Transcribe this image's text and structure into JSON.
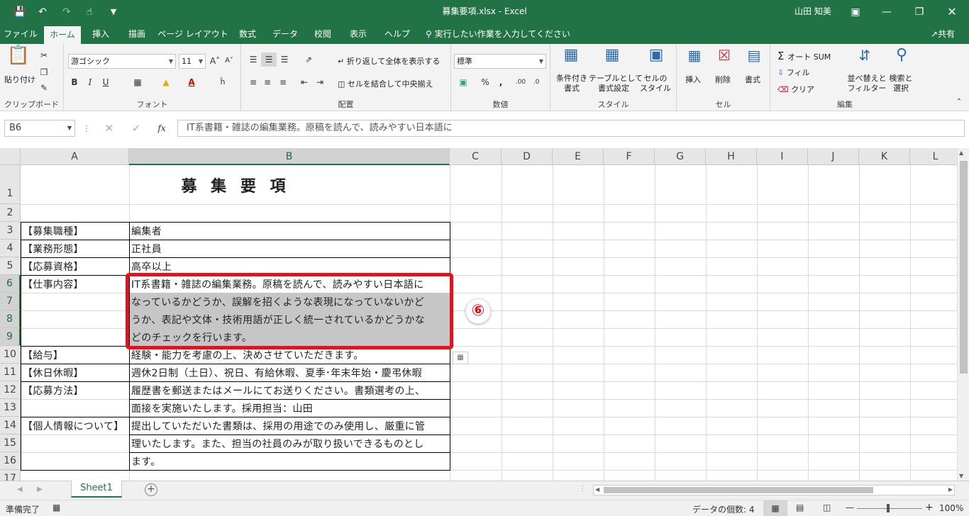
{
  "title_bar": {
    "title": "募集要項.xlsx  -  Excel",
    "user": "山田 知美"
  },
  "tabs": [
    "ファイル",
    "ホーム",
    "挿入",
    "描画",
    "ページ レイアウト",
    "数式",
    "データ",
    "校閲",
    "表示",
    "ヘルプ"
  ],
  "tell_me": "実行したい作業を入力してください",
  "share": "共有",
  "ribbon": {
    "clipboard": {
      "paste": "貼り付け",
      "label": "クリップボード"
    },
    "font": {
      "name": "游ゴシック",
      "size": "11",
      "bold": "B",
      "italic": "I",
      "underline": "U",
      "label": "フォント"
    },
    "alignment": {
      "wrap": "折り返して全体を表示する",
      "merge": "セルを結合して中央揃え",
      "label": "配置"
    },
    "number": {
      "format": "標準",
      "percent": "%",
      "comma": ",",
      "label": "数値"
    },
    "styles": {
      "cond": "条件付き\n書式",
      "table": "テーブルとして\n書式設定",
      "cell": "セルの\nスタイル",
      "label": "スタイル"
    },
    "cells": {
      "insert": "挿入",
      "delete": "削除",
      "format": "書式",
      "label": "セル"
    },
    "editing": {
      "autosum": "オート SUM",
      "fill": "フィル",
      "clear": "クリア",
      "sort": "並べ替えと\nフィルター",
      "find": "検索と\n選択",
      "label": "編集"
    }
  },
  "formula_bar": {
    "name_box": "B6",
    "content": "IT系書籍・雑誌の編集業務。原稿を読んで、読みやすい日本語に"
  },
  "columns": [
    "A",
    "B",
    "C",
    "D",
    "E",
    "F",
    "G",
    "H",
    "I",
    "J",
    "K",
    "L"
  ],
  "rows": [
    "1",
    "2",
    "3",
    "4",
    "5",
    "6",
    "7",
    "8",
    "9",
    "10",
    "11",
    "12",
    "13",
    "14",
    "15",
    "16",
    "17"
  ],
  "sheet": {
    "title": "募 集 要 項",
    "a": {
      "r3": "【募集職種】",
      "r4": "【業務形態】",
      "r5": "【応募資格】",
      "r6": "【仕事内容】",
      "r10": "【給与】",
      "r11": "【休日休暇】",
      "r12": "【応募方法】",
      "r14": "【個人情報について】"
    },
    "b": {
      "r3": "編集者",
      "r4": "正社員",
      "r5": "高卒以上",
      "r6": "IT系書籍・雑誌の編集業務。原稿を読んで、読みやすい日本語に",
      "r7": "なっているかどうか、誤解を招くような表現になっていないかど",
      "r8": "うか、表記や文体・技術用語が正しく統一されているかどうかな",
      "r9": "どのチェックを行います。",
      "r10": "経験・能力を考慮の上、決めさせていただきます。",
      "r11": "週休2日制（土日）、祝日、有給休暇、夏季･年末年始・慶弔休暇",
      "r12": "履歴書を郵送またはメールにてお送りください。書類選考の上、",
      "r13": "面接を実施いたします。採用担当：山田",
      "r14": "提出していただいた書類は、採用の用途でのみ使用し、厳重に管",
      "r15": "理いたします。また、担当の社員のみが取り扱いできるものとし",
      "r16": "ます。"
    }
  },
  "annotation": {
    "badge": "⑥"
  },
  "sheet_tab": "Sheet1",
  "status": {
    "ready": "準備完了",
    "count": "データの個数: 4",
    "zoom": "100%"
  }
}
